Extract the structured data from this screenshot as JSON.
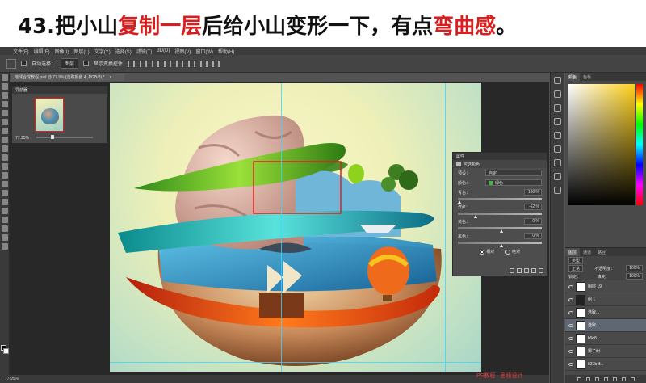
{
  "caption": {
    "step": "43.",
    "part1": "把小山",
    "highlight1": "复制一层",
    "part2": "后给小山变形一下，有点",
    "highlight2": "弯曲感",
    "end": "。"
  },
  "menubar": [
    "文件(F)",
    "编辑(E)",
    "图像(I)",
    "图层(L)",
    "文字(Y)",
    "选择(S)",
    "滤镜(T)",
    "3D(D)",
    "视图(V)",
    "窗口(W)",
    "帮助(H)"
  ],
  "options": {
    "auto_select_label": "自动选择：",
    "auto_select_value": "图层",
    "transform_controls_label": "显示变换控件"
  },
  "document": {
    "tab_title": "地球合成教程.psd @ 77.9% (选取颜色 4 ,RGB/8) *",
    "zoom": "77.95%"
  },
  "navigator": {
    "title": "导航器",
    "zoom": "77.95%"
  },
  "properties": {
    "title": "属性",
    "subtitle": "可选颜色",
    "preset_label": "预设：",
    "preset_value": "自定",
    "colors_label": "颜色：",
    "colors_value": "绿色",
    "sliders": [
      {
        "label": "青色：",
        "value": "-100 %",
        "pos": 0.0
      },
      {
        "label": "洋红：",
        "value": "-62 %",
        "pos": 0.19
      },
      {
        "label": "黄色：",
        "value": "0 %",
        "pos": 0.5
      },
      {
        "label": "黑色：",
        "value": "0 %",
        "pos": 0.5
      }
    ],
    "method_relative": "相对",
    "method_absolute": "绝对"
  },
  "color_panel": {
    "tab_color": "颜色",
    "tab_swatches": "色板",
    "accent_hue": "#ffd11a"
  },
  "layers_panel": {
    "tabs": [
      "图层",
      "通道",
      "路径"
    ],
    "kind_label": "类型",
    "blend_mode": "正常",
    "opacity_label": "不透明度：",
    "opacity_value": "100%",
    "lock_label": "锁定：",
    "fill_label": "填充：",
    "fill_value": "100%",
    "layers": [
      {
        "name": "图层 19",
        "selected": false,
        "dark": false
      },
      {
        "name": "组 1",
        "selected": false,
        "dark": true
      },
      {
        "name": "选取...",
        "selected": false,
        "dark": false
      },
      {
        "name": "选取...",
        "selected": true,
        "dark": false
      },
      {
        "name": "b9c8...",
        "selected": false,
        "dark": false
      },
      {
        "name": "椰子树",
        "selected": false,
        "dark": false
      },
      {
        "name": "837b4f...",
        "selected": false,
        "dark": false
      }
    ]
  },
  "watermark": "PS教程 · 思缘设计"
}
